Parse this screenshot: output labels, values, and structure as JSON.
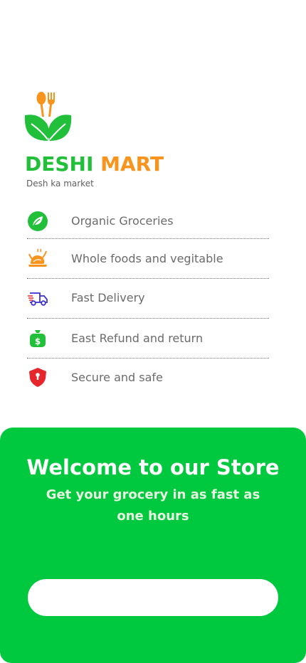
{
  "brand": {
    "name_part1": "DESHI",
    "name_part2": "MART",
    "tagline": "Desh ka market"
  },
  "features": [
    {
      "label": "Organic Groceries",
      "icon": "leaf-icon",
      "color": "#22c03a"
    },
    {
      "label": "Whole foods and vegitable",
      "icon": "roast-chicken-icon",
      "color": "#f7941d"
    },
    {
      "label": "Fast Delivery",
      "icon": "delivery-truck-icon",
      "color": "#3b2fd6"
    },
    {
      "label": "East Refund and return",
      "icon": "money-bag-icon",
      "color": "#22c03a"
    },
    {
      "label": "Secure and safe",
      "icon": "shield-lock-icon",
      "color": "#e5262c"
    }
  ],
  "welcome": {
    "title": "Welcome to our Store",
    "subtitle": "Get your grocery in as fast as one hours",
    "button_label": ""
  },
  "colors": {
    "brand_green": "#22c03a",
    "brand_orange": "#f7941d",
    "panel_green": "#00c93f"
  }
}
